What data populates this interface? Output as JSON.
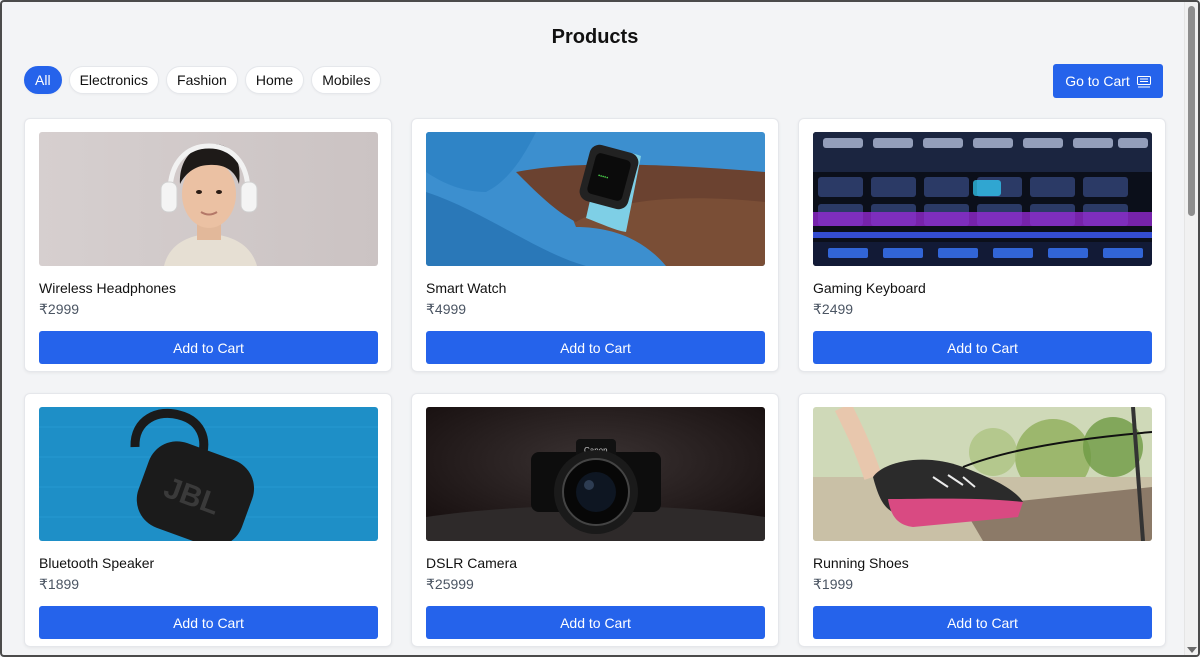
{
  "page": {
    "title": "Products"
  },
  "filters": [
    "All",
    "Electronics",
    "Fashion",
    "Home",
    "Mobiles"
  ],
  "cart_button": {
    "label": "Go to Cart"
  },
  "products": [
    {
      "name": "Wireless Headphones",
      "price": "₹2999",
      "button": "Add to Cart"
    },
    {
      "name": "Smart Watch",
      "price": "₹4999",
      "button": "Add to Cart"
    },
    {
      "name": "Gaming Keyboard",
      "price": "₹2499",
      "button": "Add to Cart"
    },
    {
      "name": "Bluetooth Speaker",
      "price": "₹1899",
      "button": "Add to Cart"
    },
    {
      "name": "DSLR Camera",
      "price": "₹25999",
      "button": "Add to Cart"
    },
    {
      "name": "Running Shoes",
      "price": "₹1999",
      "button": "Add to Cart"
    }
  ],
  "speaker_logo": "JBL",
  "camera_brand": "Canon",
  "colors": {
    "accent": "#2563eb",
    "background": "#f3f4f6",
    "card": "#ffffff"
  }
}
